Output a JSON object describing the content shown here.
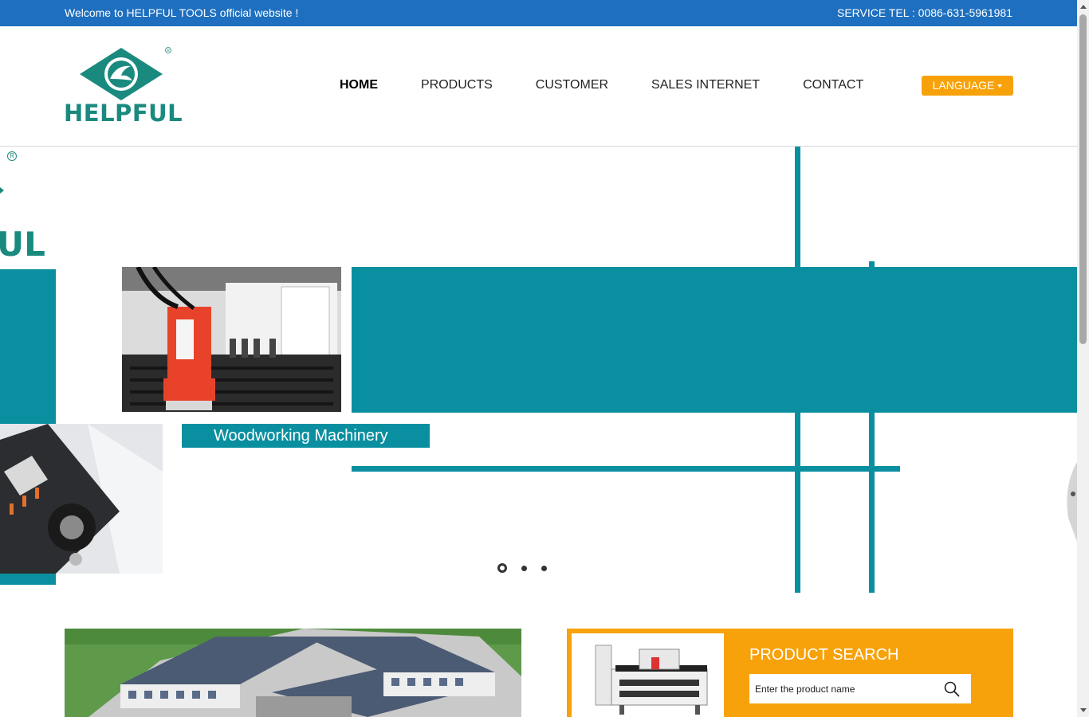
{
  "topbar": {
    "welcome": "Welcome to HELPFUL TOOLS official website !",
    "service_tel": "SERVICE TEL : 0086-631-5961981"
  },
  "logo": {
    "brand": "HELPFUL",
    "registered_mark": "R"
  },
  "nav": {
    "items": [
      {
        "label": "HOME",
        "active": true
      },
      {
        "label": "PRODUCTS",
        "active": false
      },
      {
        "label": "CUSTOMER",
        "active": false
      },
      {
        "label": "SALES INTERNET",
        "active": false
      },
      {
        "label": "CONTACT",
        "active": false
      }
    ],
    "language_label": "LANGUAGE"
  },
  "banner": {
    "caption": "Woodworking Machinery",
    "ghost_logo_fragment": "UL",
    "slides_count": 3,
    "active_slide": 1
  },
  "product_search": {
    "title": "PRODUCT SEARCH",
    "placeholder": "Enter the product name"
  },
  "colors": {
    "topbar": "#1e6fbf",
    "brand_green": "#1a8a7f",
    "banner_teal": "#0a8fa0",
    "accent_orange": "#f7a20a"
  },
  "icons": [
    "logo-diamond-icon",
    "chevron-down-icon",
    "search-icon"
  ]
}
